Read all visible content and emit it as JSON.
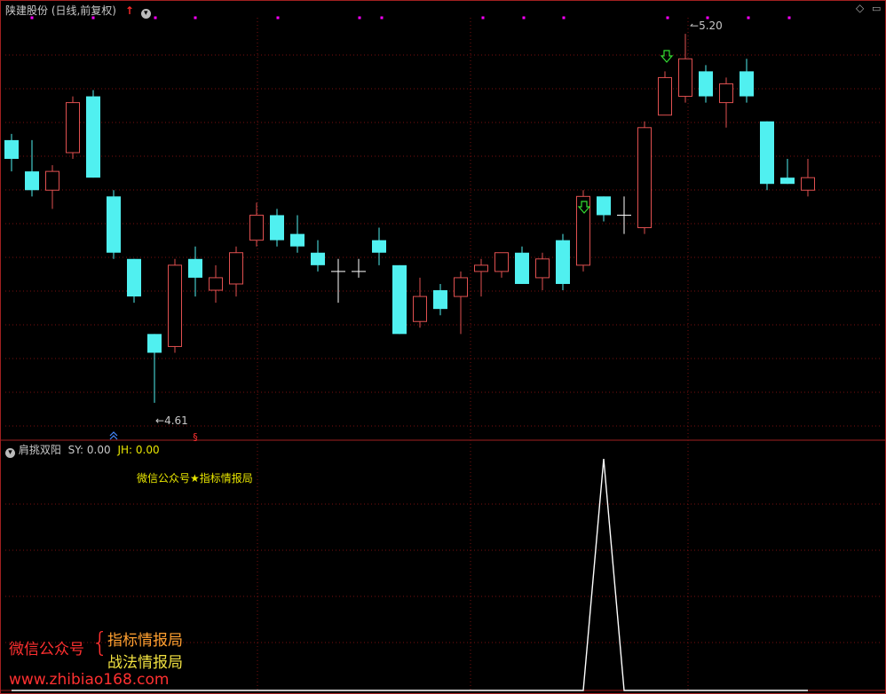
{
  "header": {
    "title": "陕建股份 (日线,前复权)",
    "diamond_icon": "diamond-icon"
  },
  "indicator": {
    "name": "肩挑双阳",
    "sy_label": "SY:",
    "sy_value": "0.00",
    "jh_label": "JH:",
    "jh_value": "0.00",
    "watermark": "微信公众号★指标情报局"
  },
  "annotations": {
    "low_label": "4.61",
    "high_label": "5.20"
  },
  "promo": {
    "left": "微信公众号",
    "line1": "指标情报局",
    "line2": "战法情报局",
    "url": "www.zhibiao168.com"
  },
  "colors": {
    "up": "#e05050",
    "down": "#50f0f0",
    "flat": "#ffffff",
    "grid": "#7a1010",
    "separator": "#a02020",
    "magenta": "#ff00ff",
    "arrow_green": "#33dd33"
  },
  "chart_data": {
    "type": "candlestick",
    "price_range": [
      4.58,
      5.22
    ],
    "candles": [
      {
        "o": 5.03,
        "h": 5.04,
        "l": 4.98,
        "c": 5.0
      },
      {
        "o": 4.98,
        "h": 5.03,
        "l": 4.94,
        "c": 4.95
      },
      {
        "o": 4.95,
        "h": 4.99,
        "l": 4.92,
        "c": 4.98
      },
      {
        "o": 5.01,
        "h": 5.1,
        "l": 5.0,
        "c": 5.09
      },
      {
        "o": 5.1,
        "h": 5.11,
        "l": 4.97,
        "c": 4.97
      },
      {
        "o": 4.94,
        "h": 4.95,
        "l": 4.84,
        "c": 4.85
      },
      {
        "o": 4.84,
        "h": 4.84,
        "l": 4.77,
        "c": 4.78
      },
      {
        "o": 4.72,
        "h": 4.72,
        "l": 4.61,
        "c": 4.69
      },
      {
        "o": 4.7,
        "h": 4.84,
        "l": 4.69,
        "c": 4.83
      },
      {
        "o": 4.84,
        "h": 4.86,
        "l": 4.78,
        "c": 4.81
      },
      {
        "o": 4.79,
        "h": 4.83,
        "l": 4.77,
        "c": 4.81
      },
      {
        "o": 4.8,
        "h": 4.86,
        "l": 4.78,
        "c": 4.85
      },
      {
        "o": 4.87,
        "h": 4.93,
        "l": 4.86,
        "c": 4.91
      },
      {
        "o": 4.91,
        "h": 4.92,
        "l": 4.86,
        "c": 4.87
      },
      {
        "o": 4.88,
        "h": 4.91,
        "l": 4.85,
        "c": 4.86
      },
      {
        "o": 4.85,
        "h": 4.87,
        "l": 4.82,
        "c": 4.83
      },
      {
        "o": 4.82,
        "h": 4.84,
        "l": 4.77,
        "c": 4.82
      },
      {
        "o": 4.82,
        "h": 4.84,
        "l": 4.81,
        "c": 4.82
      },
      {
        "o": 4.87,
        "h": 4.89,
        "l": 4.83,
        "c": 4.85
      },
      {
        "o": 4.83,
        "h": 4.83,
        "l": 4.72,
        "c": 4.72
      },
      {
        "o": 4.74,
        "h": 4.81,
        "l": 4.73,
        "c": 4.78
      },
      {
        "o": 4.79,
        "h": 4.8,
        "l": 4.75,
        "c": 4.76
      },
      {
        "o": 4.78,
        "h": 4.82,
        "l": 4.72,
        "c": 4.81
      },
      {
        "o": 4.82,
        "h": 4.84,
        "l": 4.78,
        "c": 4.83
      },
      {
        "o": 4.82,
        "h": 4.85,
        "l": 4.81,
        "c": 4.85
      },
      {
        "o": 4.85,
        "h": 4.86,
        "l": 4.8,
        "c": 4.8
      },
      {
        "o": 4.81,
        "h": 4.85,
        "l": 4.79,
        "c": 4.84
      },
      {
        "o": 4.87,
        "h": 4.88,
        "l": 4.79,
        "c": 4.8
      },
      {
        "o": 4.83,
        "h": 4.95,
        "l": 4.82,
        "c": 4.94
      },
      {
        "o": 4.94,
        "h": 4.94,
        "l": 4.9,
        "c": 4.91
      },
      {
        "o": 4.91,
        "h": 4.94,
        "l": 4.88,
        "c": 4.91
      },
      {
        "o": 4.89,
        "h": 5.06,
        "l": 4.88,
        "c": 5.05
      },
      {
        "o": 5.07,
        "h": 5.14,
        "l": 5.07,
        "c": 5.13
      },
      {
        "o": 5.1,
        "h": 5.2,
        "l": 5.09,
        "c": 5.16
      },
      {
        "o": 5.14,
        "h": 5.15,
        "l": 5.09,
        "c": 5.1
      },
      {
        "o": 5.09,
        "h": 5.13,
        "l": 5.05,
        "c": 5.12
      },
      {
        "o": 5.14,
        "h": 5.16,
        "l": 5.09,
        "c": 5.1
      },
      {
        "o": 5.06,
        "h": 5.06,
        "l": 4.95,
        "c": 4.96
      },
      {
        "o": 4.97,
        "h": 5.0,
        "l": 4.96,
        "c": 4.96
      },
      {
        "o": 4.95,
        "h": 5.0,
        "l": 4.94,
        "c": 4.97
      }
    ],
    "indicator_series": {
      "name": "JH",
      "values": [
        0,
        0,
        0,
        0,
        0,
        0,
        0,
        0,
        0,
        0,
        0,
        0,
        0,
        0,
        0,
        0,
        0,
        0,
        0,
        0,
        0,
        0,
        0,
        0,
        0,
        0,
        0,
        0,
        0,
        1,
        0,
        0,
        0,
        0,
        0,
        0,
        0,
        0,
        0,
        0
      ]
    }
  }
}
